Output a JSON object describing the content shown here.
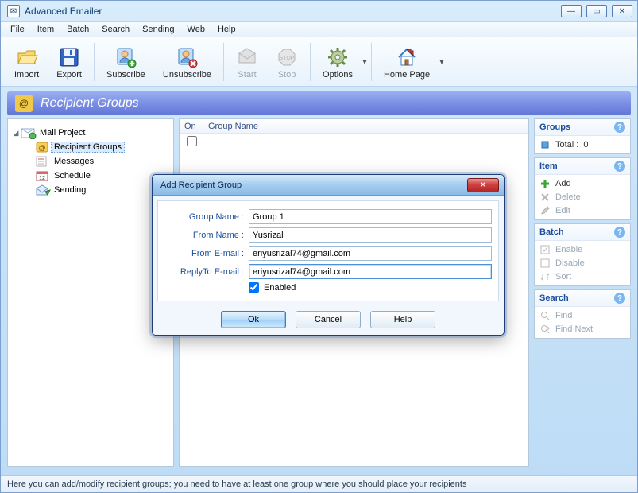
{
  "app": {
    "title": "Advanced Emailer"
  },
  "menubar": [
    "File",
    "Item",
    "Batch",
    "Search",
    "Sending",
    "Web",
    "Help"
  ],
  "toolbar": {
    "import": "Import",
    "export": "Export",
    "subscribe": "Subscribe",
    "unsubscribe": "Unsubscribe",
    "start": "Start",
    "stop": "Stop",
    "options": "Options",
    "home": "Home Page"
  },
  "section": {
    "title": "Recipient Groups"
  },
  "tree": {
    "root": "Mail Project",
    "items": [
      {
        "label": "Recipient Groups"
      },
      {
        "label": "Messages"
      },
      {
        "label": "Schedule"
      },
      {
        "label": "Sending"
      }
    ]
  },
  "table": {
    "cols": {
      "on": "On",
      "name": "Group Name"
    }
  },
  "side": {
    "groups": {
      "title": "Groups",
      "total_label": "Total :",
      "total": "0"
    },
    "item": {
      "title": "Item",
      "add": "Add",
      "delete": "Delete",
      "edit": "Edit"
    },
    "batch": {
      "title": "Batch",
      "enable": "Enable",
      "disable": "Disable",
      "sort": "Sort"
    },
    "search": {
      "title": "Search",
      "find": "Find",
      "findnext": "Find Next"
    }
  },
  "dialog": {
    "title": "Add Recipient Group",
    "labels": {
      "group": "Group Name :",
      "fromname": "From Name :",
      "fromemail": "From E-mail :",
      "replyto": "ReplyTo E-mail :",
      "enabled": "Enabled"
    },
    "values": {
      "group": "Group 1",
      "fromname": "Yusrizal",
      "fromemail": "eriyusrizal74@gmail.com",
      "replyto": "eriyusrizal74@gmail.com",
      "enabled": true
    },
    "buttons": {
      "ok": "Ok",
      "cancel": "Cancel",
      "help": "Help"
    }
  },
  "status": "Here you can add/modify recipient groups; you need to have at least one group where you should place your recipients"
}
